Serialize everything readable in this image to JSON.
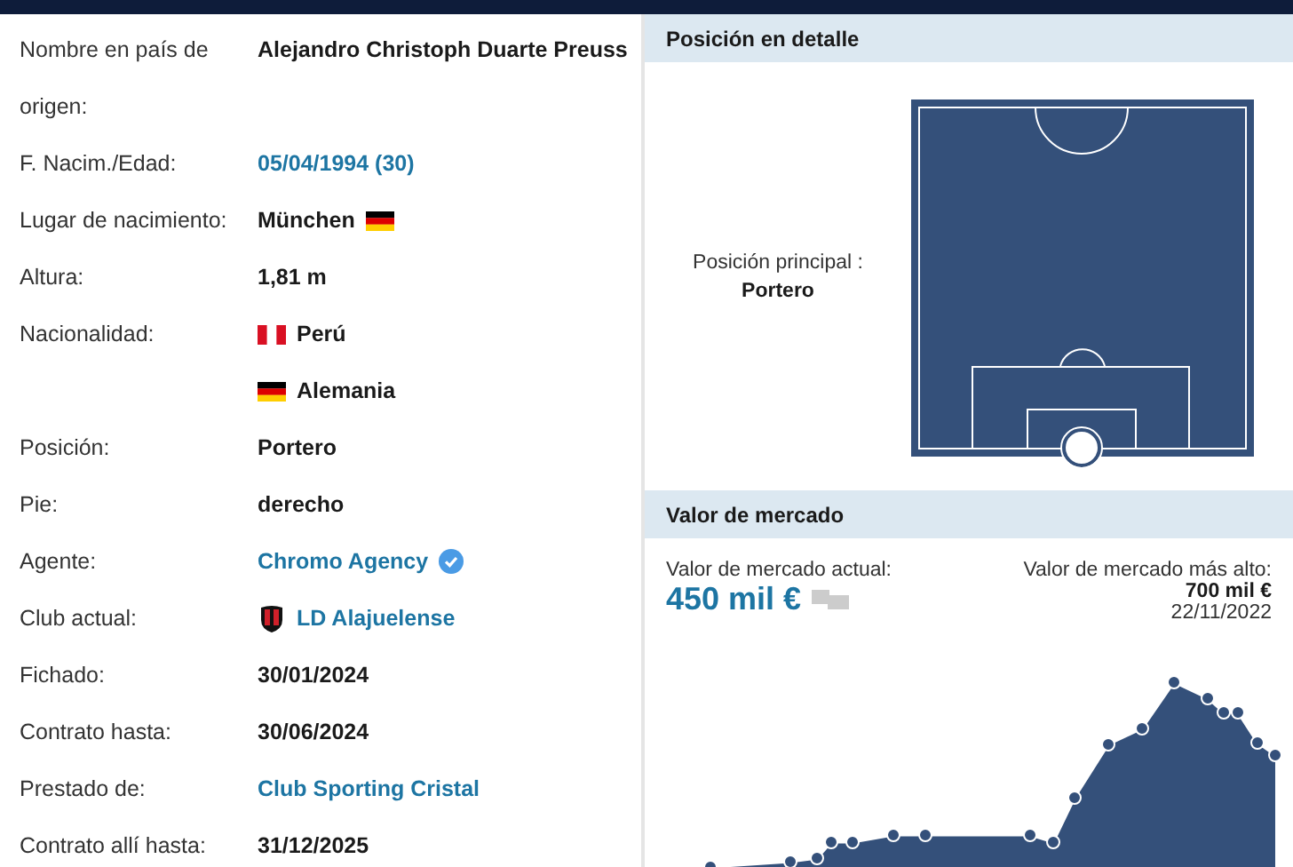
{
  "player_data": {
    "rows": [
      {
        "label": "Nombre en país de origen:",
        "values": [
          {
            "text": "Alejandro Christoph Duarte Preuss",
            "kind": "text"
          }
        ]
      },
      {
        "label": "F. Nacim./Edad:",
        "values": [
          {
            "text": "05/04/1994 (30)",
            "kind": "link"
          }
        ]
      },
      {
        "label": "Lugar de nacimiento:",
        "values": [
          {
            "text": "München",
            "kind": "text",
            "flag_after": {
              "kind": "de"
            }
          }
        ]
      },
      {
        "label": "Altura:",
        "values": [
          {
            "text": "1,81 m",
            "kind": "text"
          }
        ]
      },
      {
        "label": "Nacionalidad:",
        "values": [
          {
            "text": "Perú",
            "kind": "text",
            "flag_before": {
              "kind": "pe"
            }
          },
          {
            "text": "Alemania",
            "kind": "text",
            "flag_before": {
              "kind": "de"
            }
          }
        ]
      },
      {
        "label": "Posición:",
        "values": [
          {
            "text": "Portero",
            "kind": "text"
          }
        ]
      },
      {
        "label": "Pie:",
        "values": [
          {
            "text": "derecho",
            "kind": "text"
          }
        ]
      },
      {
        "label": "Agente:",
        "values": [
          {
            "text": "Chromo Agency",
            "kind": "link",
            "verified": true
          }
        ]
      },
      {
        "label": "Club actual:",
        "values": [
          {
            "text": "LD Alajuelense",
            "kind": "link",
            "crest": true
          }
        ]
      },
      {
        "label": "Fichado:",
        "values": [
          {
            "text": "30/01/2024",
            "kind": "text"
          }
        ]
      },
      {
        "label": "Contrato hasta:",
        "values": [
          {
            "text": "30/06/2024",
            "kind": "text"
          }
        ]
      },
      {
        "label": "Prestado de:",
        "values": [
          {
            "text": "Club Sporting Cristal",
            "kind": "link"
          }
        ]
      },
      {
        "label": "Contrato allí hasta:",
        "values": [
          {
            "text": "31/12/2025",
            "kind": "text"
          }
        ]
      }
    ]
  },
  "position_detail": {
    "title": "Posición en detalle",
    "main_label": "Posición principal :",
    "main_value": "Portero"
  },
  "market_value": {
    "title": "Valor de mercado",
    "current_label": "Valor de mercado actual:",
    "current_value": "450 mil €",
    "highest_label": "Valor de mercado más alto:",
    "highest_value": "700 mil €",
    "highest_date": "22/11/2022"
  }
}
